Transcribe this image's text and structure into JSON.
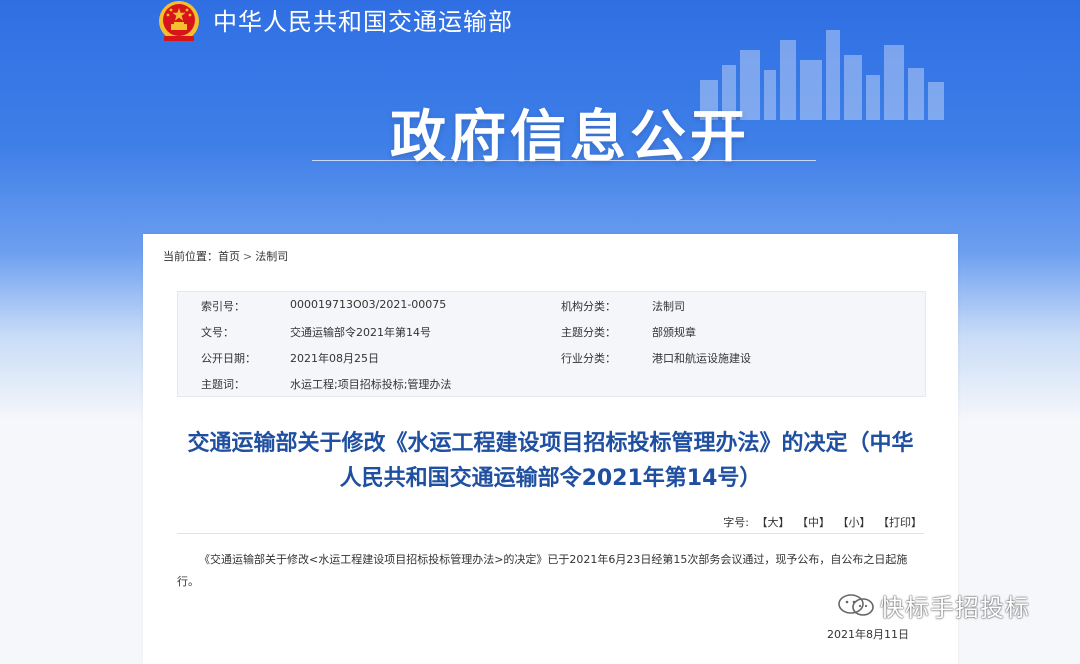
{
  "header": {
    "ministry_name": "中华人民共和国交通运输部",
    "banner_title": "政府信息公开"
  },
  "breadcrumb": {
    "prefix": "当前位置：",
    "items": [
      "首页",
      "法制司"
    ],
    "separator": ">"
  },
  "info": {
    "index_label": "索引号：",
    "index_value": "000019713O03/2021-00075",
    "org_label": "机构分类：",
    "org_value": "法制司",
    "doc_no_label": "文号：",
    "doc_no_value": "交通运输部令2021年第14号",
    "topic_label": "主题分类：",
    "topic_value": "部颁规章",
    "pub_date_label": "公开日期：",
    "pub_date_value": "2021年08月25日",
    "industry_label": "行业分类：",
    "industry_value": "港口和航运设施建设",
    "keywords_label": "主题词：",
    "keywords_value": "水运工程;项目招标投标;管理办法"
  },
  "document": {
    "title": "交通运输部关于修改《水运工程建设项目招标投标管理办法》的决定（中华人民共和国交通运输部令2021年第14号）",
    "font_size_label": "字号:",
    "font_large": "【大】",
    "font_medium": "【中】",
    "font_small": "【小】",
    "print": "【打印】",
    "body": "《交通运输部关于修改<水运工程建设项目招标投标管理办法>的决定》已于2021年6月23日经第15次部务会议通过，现予公布，自公布之日起施行。",
    "date": "2021年8月11日"
  },
  "watermark": {
    "text": "快标手招投标"
  },
  "colors": {
    "banner_blue": "#2f6fe3",
    "title_blue": "#1f4fa0",
    "emblem_red": "#d8141b",
    "emblem_gold": "#f6c02c"
  }
}
